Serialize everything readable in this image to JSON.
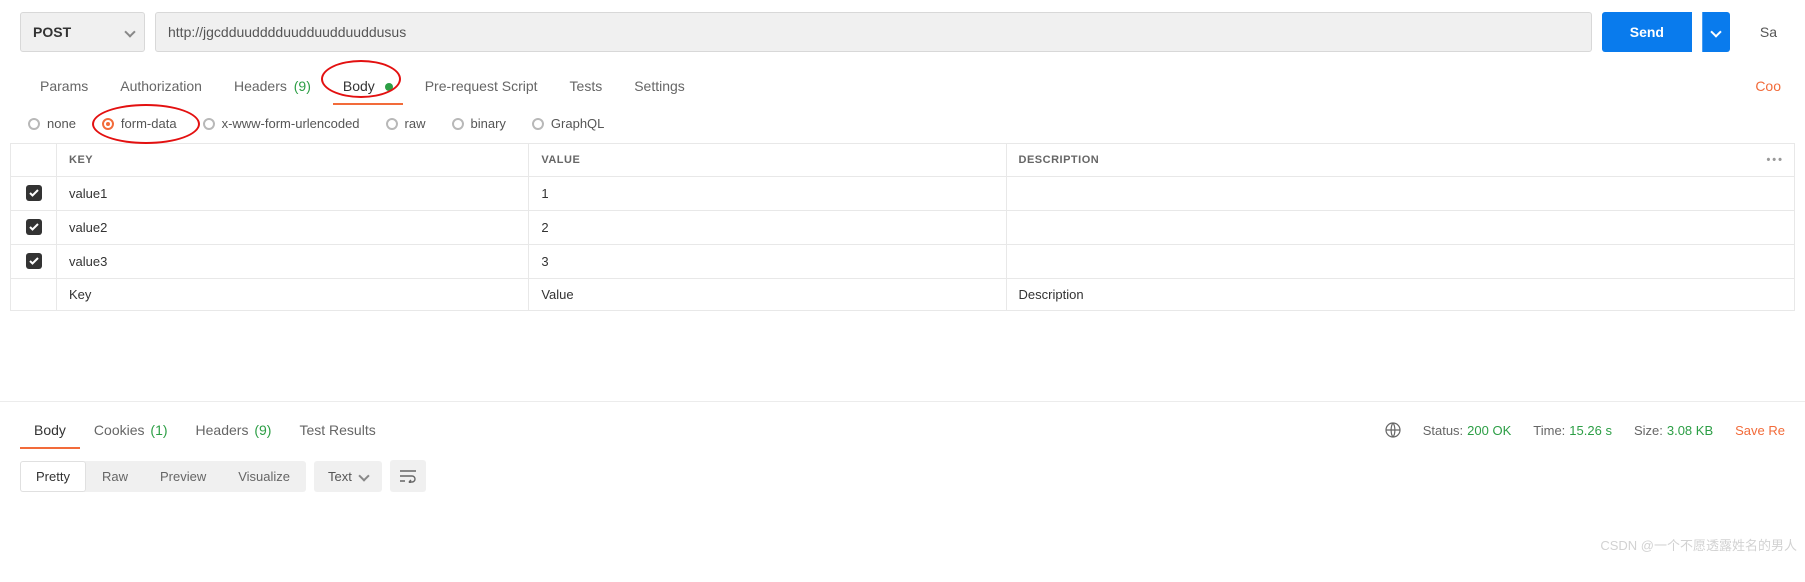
{
  "request": {
    "method": "POST",
    "url": "http://jgcdduudddduudduudduuddusus",
    "send_label": "Send",
    "save_label": "Sa"
  },
  "tabs": {
    "params": "Params",
    "auth": "Authorization",
    "headers": "Headers",
    "headers_count": "(9)",
    "body": "Body",
    "prerequest": "Pre-request Script",
    "tests": "Tests",
    "settings": "Settings",
    "cookies_link": "Coo"
  },
  "body_types": {
    "none": "none",
    "form_data": "form-data",
    "url_encoded": "x-www-form-urlencoded",
    "raw": "raw",
    "binary": "binary",
    "graphql": "GraphQL"
  },
  "table": {
    "headers": {
      "key": "KEY",
      "value": "VALUE",
      "desc": "DESCRIPTION"
    },
    "rows": [
      {
        "key": "value1",
        "value": "1",
        "desc": ""
      },
      {
        "key": "value2",
        "value": "2",
        "desc": ""
      },
      {
        "key": "value3",
        "value": "3",
        "desc": ""
      }
    ],
    "placeholders": {
      "key": "Key",
      "value": "Value",
      "desc": "Description"
    }
  },
  "response": {
    "tabs": {
      "body": "Body",
      "cookies": "Cookies",
      "cookies_count": "(1)",
      "headers": "Headers",
      "headers_count": "(9)",
      "tests": "Test Results"
    },
    "status_label": "Status:",
    "status_value": "200 OK",
    "time_label": "Time:",
    "time_value": "15.26 s",
    "size_label": "Size:",
    "size_value": "3.08 KB",
    "save_label": "Save Re"
  },
  "view": {
    "pretty": "Pretty",
    "raw": "Raw",
    "preview": "Preview",
    "visualize": "Visualize",
    "format": "Text"
  },
  "watermark": "CSDN @一个不愿透露姓名的男人"
}
